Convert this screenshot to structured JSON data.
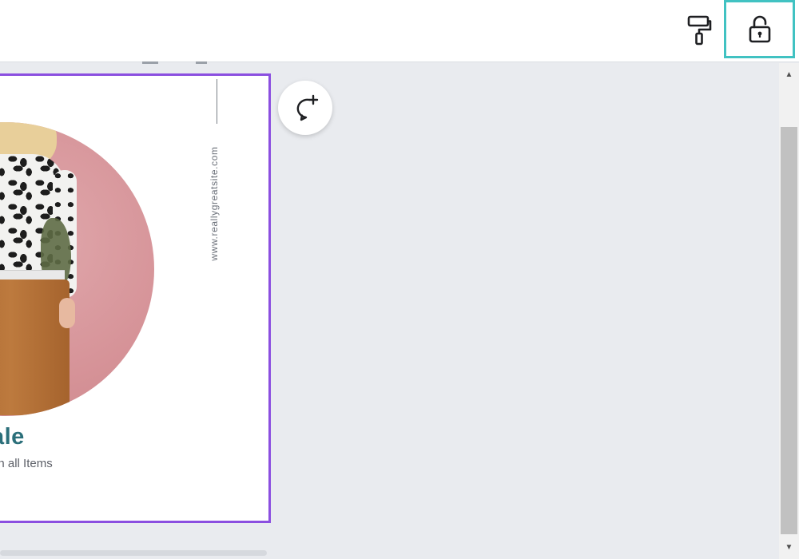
{
  "toolbar": {
    "paint_format_icon": "paint-roller-icon",
    "lock_icon": "unlock-icon",
    "lock_highlight_color": "#41c2c2"
  },
  "canvas": {
    "selection_color": "#8b4fe0",
    "website": "www.reallygreatsite.com",
    "headline": "ale",
    "subline": "on all Items",
    "headline_color": "#2b6f7a",
    "comment_icon": "add-comment-icon"
  },
  "scrollbar": {
    "up_arrow": "▲",
    "down_arrow": "▼"
  }
}
